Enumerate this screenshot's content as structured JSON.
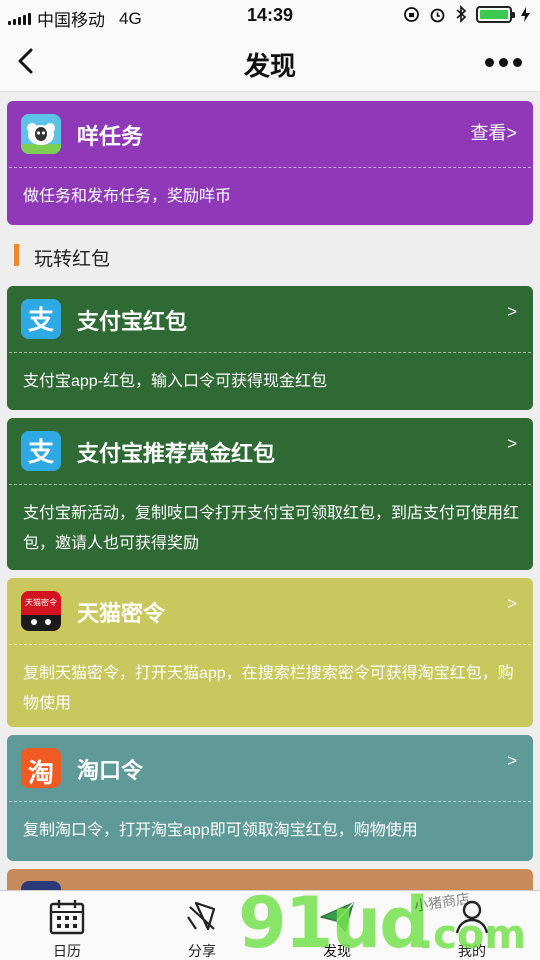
{
  "status_bar": {
    "carrier": "中国移动",
    "network": "4G",
    "time": "14:39"
  },
  "nav": {
    "title": "发现"
  },
  "cards": {
    "task": {
      "title": "咩任务",
      "link": "查看>",
      "desc": "做任务和发布任务，奖励咩币",
      "color": "#8f39b8"
    },
    "alipay": {
      "title": "支付宝红包",
      "arrow": ">",
      "desc": "支付宝app-红包，输入口令可获得现金红包",
      "color": "#2f6a35"
    },
    "alipay_ref": {
      "title": "支付宝推荐赏金红包",
      "arrow": ">",
      "desc": "支付宝新活动，复制吱口令打开支付宝可领取红包，到店支付可使用红包，邀请人也可获得奖励",
      "color": "#2f6a35"
    },
    "tmall": {
      "title": "天猫密令",
      "arrow": ">",
      "icon_text": "天猫密令",
      "desc": "复制天猫密令，打开天猫app，在搜索栏搜索密令可获得淘宝红包，购物使用",
      "color": "#c9c85e"
    },
    "taobao": {
      "title": "淘口令",
      "arrow": ">",
      "icon_text": "淘",
      "desc": "复制淘口令，打开淘宝app即可领取淘宝红包，购物使用",
      "color": "#5f9a99"
    }
  },
  "section": {
    "label": "玩转红包",
    "accent": "#f0882a"
  },
  "tabs": [
    {
      "label": "日历",
      "icon": "calendar-icon"
    },
    {
      "label": "分享",
      "icon": "share-icon"
    },
    {
      "label": "发现",
      "icon": "paper-plane-icon",
      "active": true
    },
    {
      "label": "我的",
      "icon": "user-icon"
    }
  ],
  "watermark": {
    "text": "91ud",
    "suffix": ".com",
    "note": "小猪商店"
  }
}
